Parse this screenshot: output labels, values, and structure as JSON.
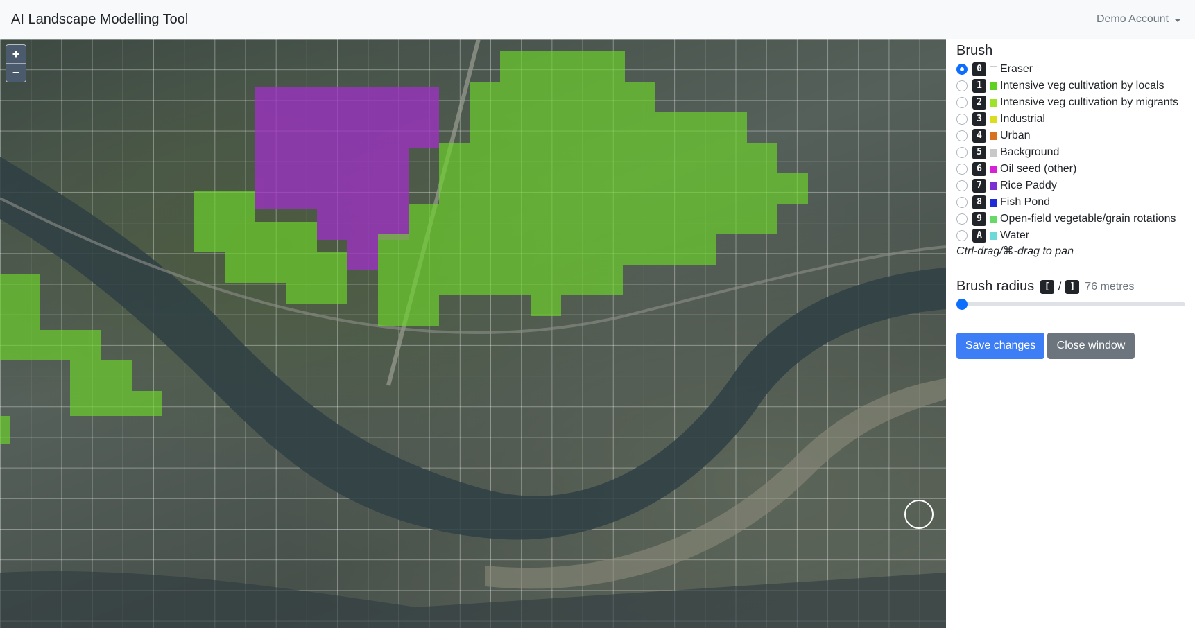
{
  "app": {
    "title": "AI Landscape Modelling Tool",
    "account": "Demo Account"
  },
  "map": {
    "zoom_in": "+",
    "zoom_out": "−"
  },
  "brush": {
    "heading": "Brush",
    "items": [
      {
        "key": "0",
        "label": "Eraser",
        "color": "#ffffff",
        "checked": true
      },
      {
        "key": "1",
        "label": "Intensive veg cultivation by locals",
        "color": "#5fd11f"
      },
      {
        "key": "2",
        "label": "Intensive veg cultivation by migrants",
        "color": "#9ee22a"
      },
      {
        "key": "3",
        "label": "Industrial",
        "color": "#dddd1f"
      },
      {
        "key": "4",
        "label": "Urban",
        "color": "#d8711f"
      },
      {
        "key": "5",
        "label": "Background",
        "color": "#c8c8c8"
      },
      {
        "key": "6",
        "label": "Oil seed (other)",
        "color": "#d621d6"
      },
      {
        "key": "7",
        "label": "Rice Paddy",
        "color": "#7b2ed6"
      },
      {
        "key": "8",
        "label": "Fish Pond",
        "color": "#1f2bd6"
      },
      {
        "key": "9",
        "label": "Open-field vegetable/grain rotations",
        "color": "#68d868"
      },
      {
        "key": "A",
        "label": "Water",
        "color": "#6ed9d9"
      }
    ],
    "pan_hint": "Ctrl-drag/⌘-drag to pan"
  },
  "radius": {
    "label": "Brush radius",
    "key_dec": "[",
    "sep": "/",
    "key_inc": "]",
    "value": "76 metres",
    "level": 0
  },
  "buttons": {
    "save": "Save changes",
    "close": "Close window"
  }
}
